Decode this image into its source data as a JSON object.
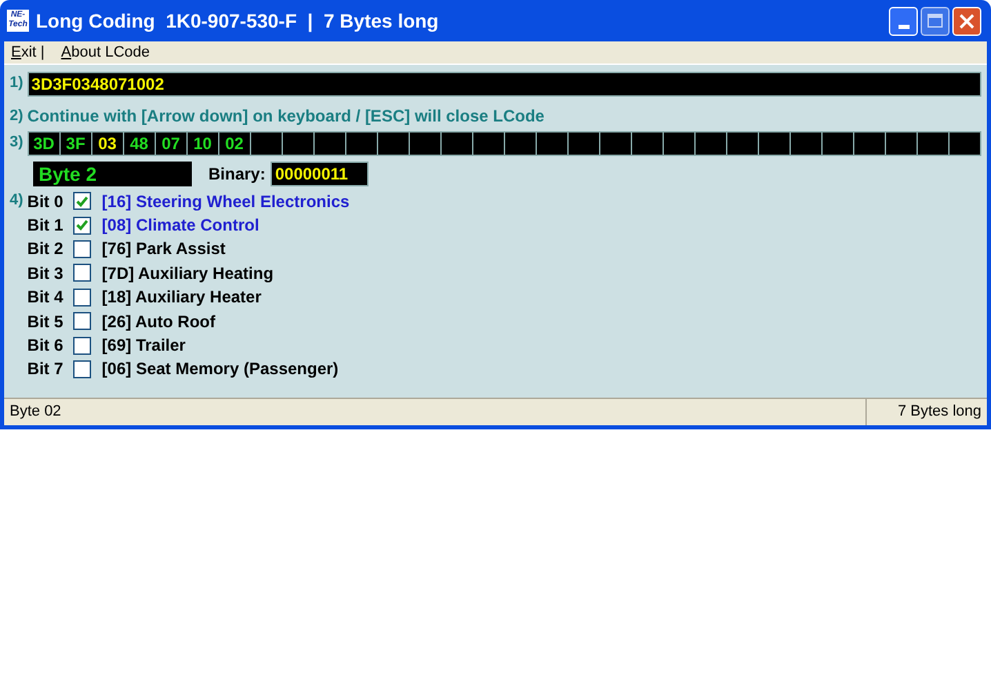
{
  "window": {
    "logo_lines": [
      "NE-",
      "Tech"
    ],
    "title": "Long Coding  1K0-907-530-F  |  7 Bytes long"
  },
  "menu": [
    {
      "label": "Exit |"
    },
    {
      "label": "About LCode"
    }
  ],
  "steps": {
    "coding": {
      "marker": "1)",
      "value": "3D3F0348071002"
    },
    "hint": {
      "marker": "2)",
      "text": "Continue with [Arrow down] on keyboard / [ESC] will close LCode"
    },
    "bytes": {
      "marker": "3)",
      "cells": [
        {
          "value": "3D",
          "selected": false
        },
        {
          "value": "3F",
          "selected": false
        },
        {
          "value": "03",
          "selected": true
        },
        {
          "value": "48",
          "selected": false
        },
        {
          "value": "07",
          "selected": false
        },
        {
          "value": "10",
          "selected": false
        },
        {
          "value": "02",
          "selected": false
        }
      ]
    },
    "byte_label": "Byte 2",
    "binary_label": "Binary:",
    "binary_value": "00000011",
    "bits": {
      "marker": "4)",
      "items": [
        {
          "bit": "Bit 0",
          "label": "[16] Steering Wheel Electronics",
          "checked": true
        },
        {
          "bit": "Bit 1",
          "label": "[08] Climate Control",
          "checked": true
        },
        {
          "bit": "Bit 2",
          "label": "[76] Park Assist",
          "checked": false
        },
        {
          "bit": "Bit 3",
          "label": "[7D] Auxiliary Heating",
          "checked": false
        },
        {
          "bit": "Bit 4",
          "label": "[18] Auxiliary Heater",
          "checked": false
        },
        {
          "bit": "Bit 5",
          "label": "[26] Auto Roof",
          "checked": false
        },
        {
          "bit": "Bit 6",
          "label": "[69] Trailer",
          "checked": false
        },
        {
          "bit": "Bit 7",
          "label": "[06] Seat Memory (Passenger)",
          "checked": false
        }
      ]
    }
  },
  "status_bar": {
    "left": "Byte 02",
    "right": "7 Bytes long"
  }
}
